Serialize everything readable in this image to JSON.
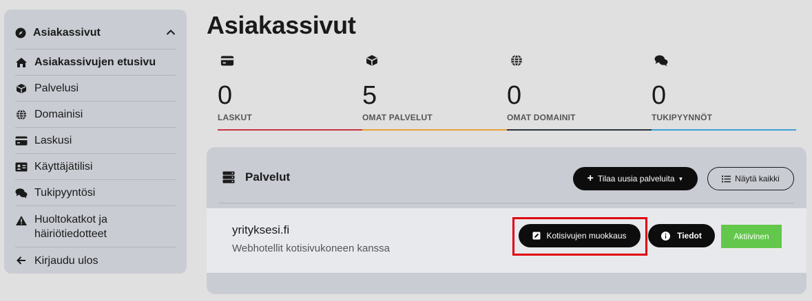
{
  "sidebar": {
    "header": {
      "title": "Asiakassivut",
      "icon": "compass-icon"
    },
    "items": [
      {
        "label": "Asiakassivujen etusivu",
        "icon": "home-icon",
        "active": true
      },
      {
        "label": "Palvelusi",
        "icon": "cube-icon"
      },
      {
        "label": "Domainisi",
        "icon": "globe-icon"
      },
      {
        "label": "Laskusi",
        "icon": "credit-card-icon"
      },
      {
        "label": "Käyttäjätilisi",
        "icon": "id-card-icon"
      },
      {
        "label": "Tukipyyntösi",
        "icon": "comments-icon"
      },
      {
        "label": "Huoltokatkot ja häiriötiedotteet",
        "icon": "warning-icon"
      },
      {
        "label": "Kirjaudu ulos",
        "icon": "arrow-left-icon"
      }
    ]
  },
  "page": {
    "title": "Asiakassivut"
  },
  "stats": [
    {
      "value": "0",
      "label": "LASKUT",
      "icon": "credit-card-icon",
      "color": "#c8323c"
    },
    {
      "value": "5",
      "label": "OMAT PALVELUT",
      "icon": "cube-icon",
      "color": "#e8a035"
    },
    {
      "value": "0",
      "label": "OMAT DOMAINIT",
      "icon": "globe-icon",
      "color": "#2a2f3a"
    },
    {
      "value": "0",
      "label": "TUKIPYYNNÖT",
      "icon": "comments-icon",
      "color": "#3ba0d8"
    }
  ],
  "services_panel": {
    "title": "Palvelut",
    "icon": "server-icon",
    "order_button": "Tilaa uusia palveluita",
    "show_all_button": "Näytä kaikki",
    "service": {
      "name": "yrityksesi.fi",
      "description": "Webhotellit kotisivukoneen kanssa",
      "edit_button": "Kotisivujen muokkaus",
      "info_button": "Tiedot",
      "status": "Aktiivinen",
      "status_color": "#63c74c"
    }
  }
}
